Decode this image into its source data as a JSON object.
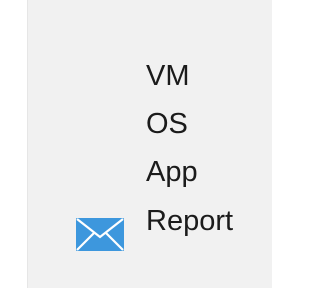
{
  "menu": {
    "items": [
      {
        "label": "VM"
      },
      {
        "label": "OS"
      },
      {
        "label": "App"
      },
      {
        "label": "Report",
        "icon": "mail-icon"
      }
    ]
  },
  "colors": {
    "panel_bg": "#f1f1f1",
    "text": "#1b1b1b",
    "mail_icon": "#3d97dd"
  }
}
